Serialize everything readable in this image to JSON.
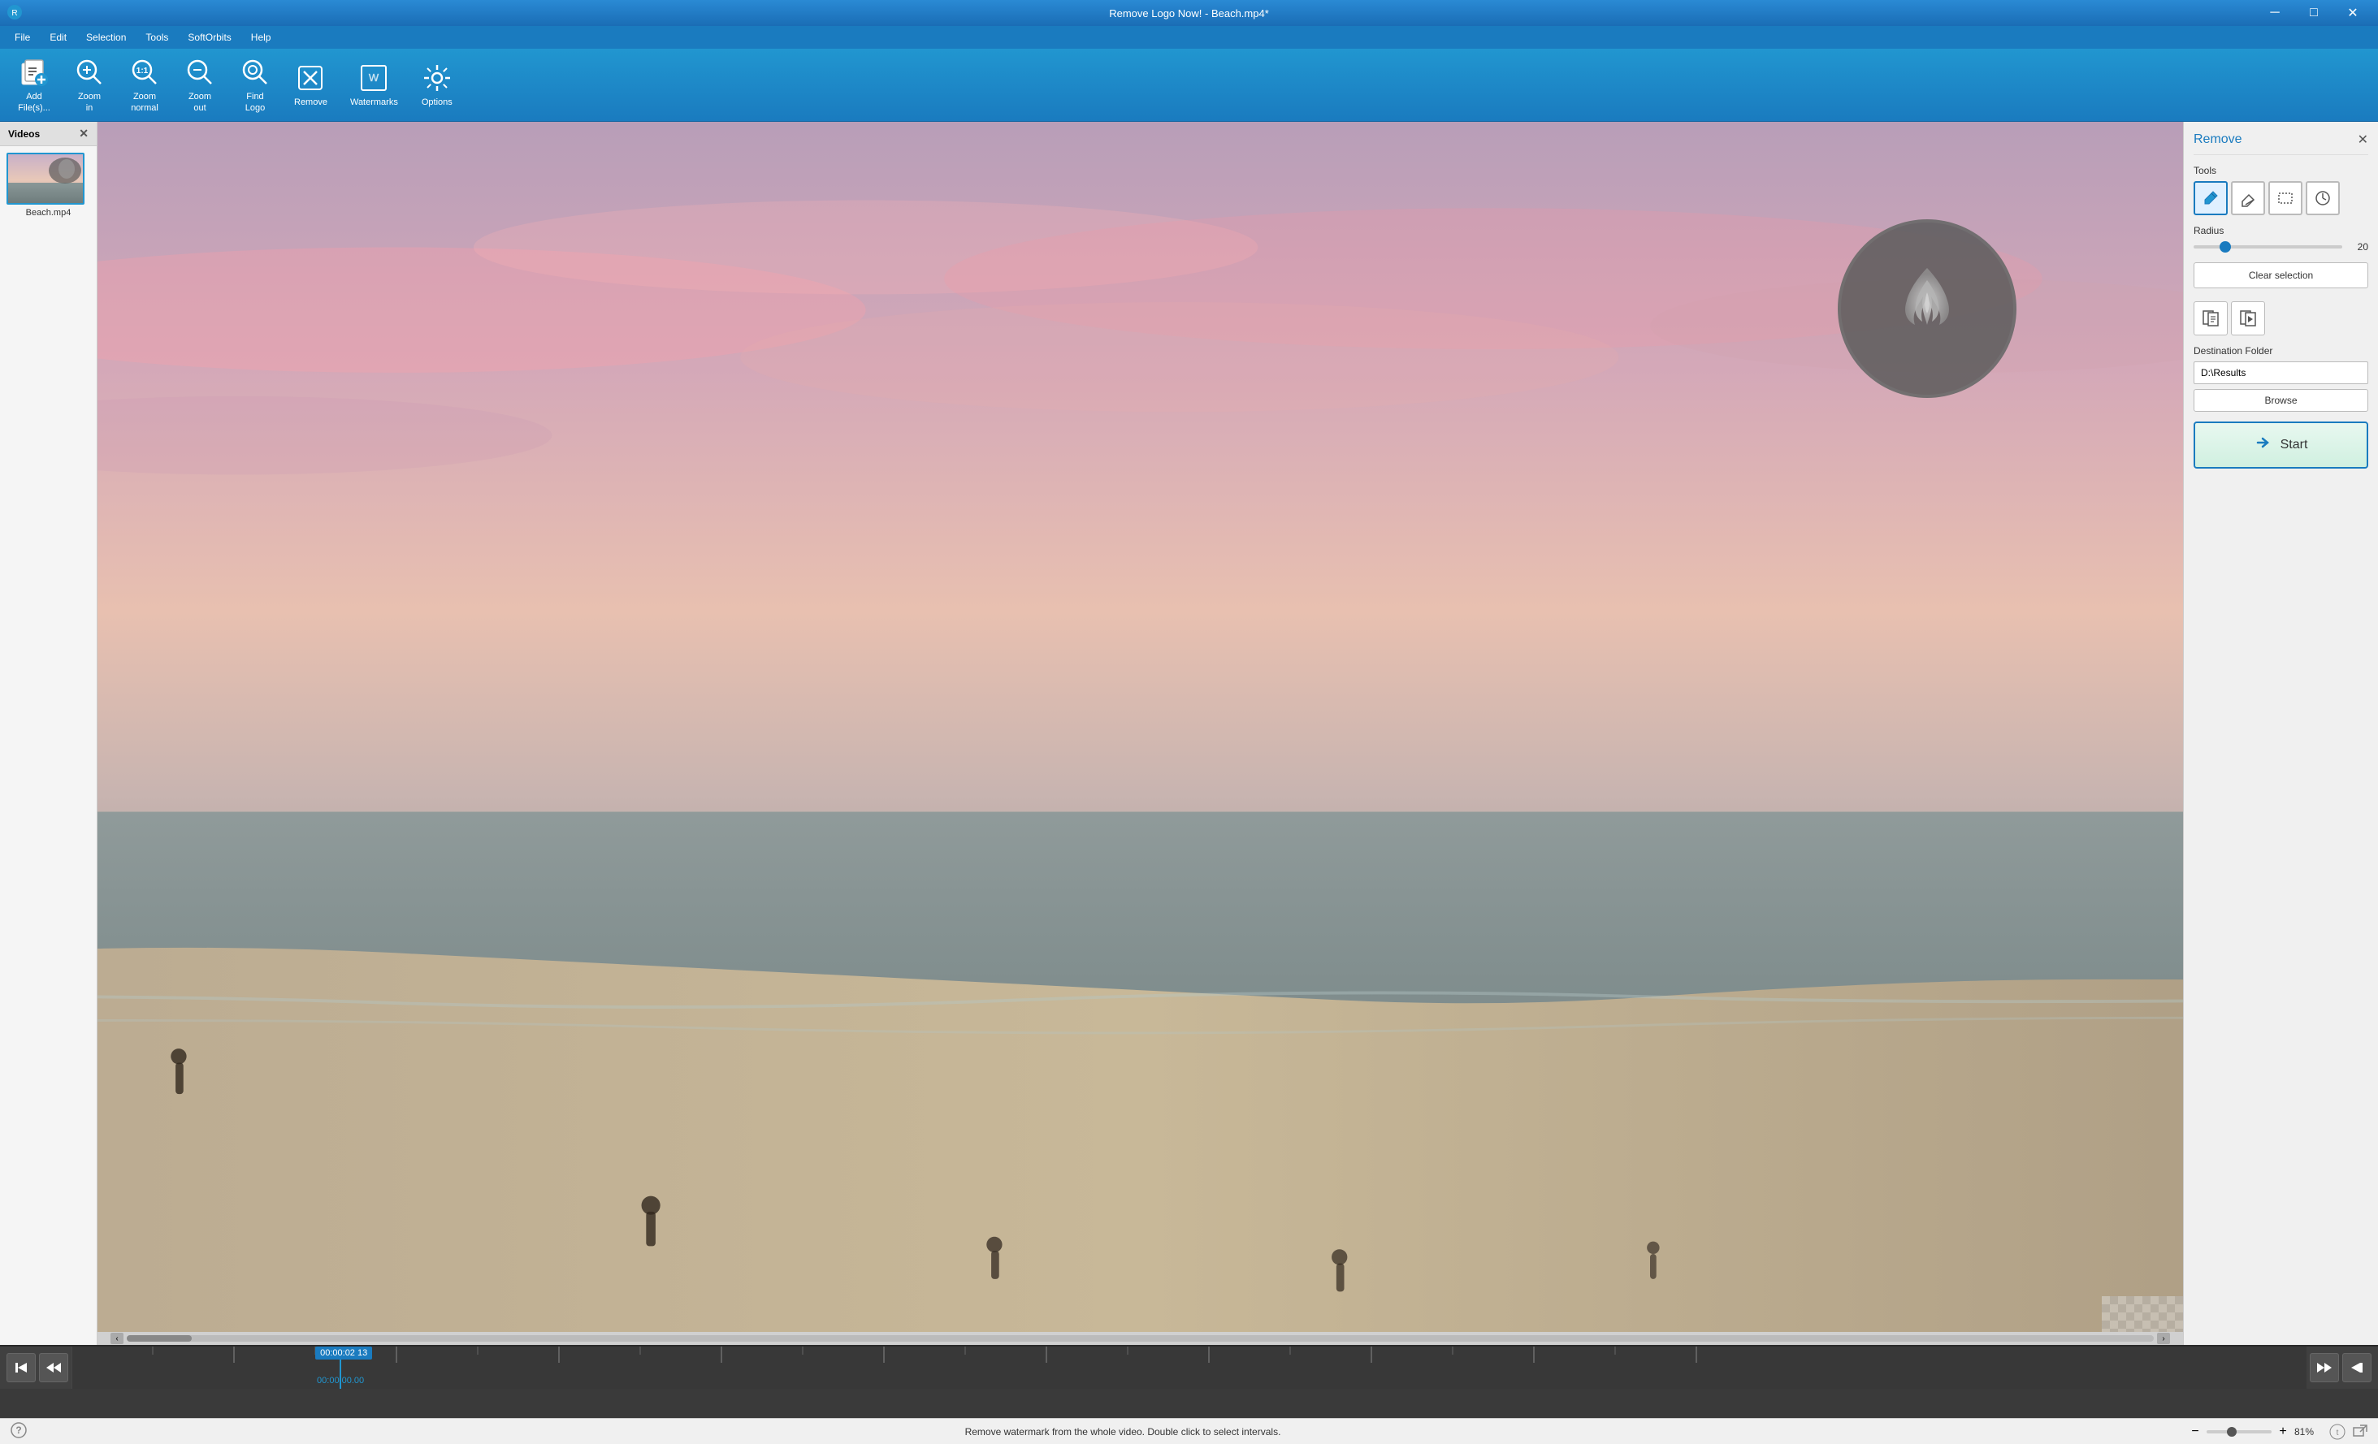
{
  "app": {
    "title": "Remove Logo Now! - Beach.mp4*"
  },
  "titlebar": {
    "icon": "🎬",
    "minimize_label": "─",
    "maximize_label": "□",
    "close_label": "✕"
  },
  "menu": {
    "items": [
      {
        "label": "File"
      },
      {
        "label": "Edit"
      },
      {
        "label": "Selection"
      },
      {
        "label": "Tools"
      },
      {
        "label": "SoftOrbits"
      },
      {
        "label": "Help"
      }
    ]
  },
  "toolbar": {
    "buttons": [
      {
        "label": "Add\nFile(s)...",
        "icon": "add"
      },
      {
        "label": "Zoom\nin",
        "icon": "zoom-in"
      },
      {
        "label": "Zoom\nnormal",
        "icon": "zoom-normal"
      },
      {
        "label": "Zoom\nout",
        "icon": "zoom-out"
      },
      {
        "label": "Find\nLogo",
        "icon": "find"
      },
      {
        "label": "Remove",
        "icon": "remove"
      },
      {
        "label": "Watermarks",
        "icon": "watermarks"
      },
      {
        "label": "Options",
        "icon": "options"
      }
    ]
  },
  "sidebar": {
    "title": "Videos",
    "video": {
      "name": "Beach.mp4"
    }
  },
  "right_panel": {
    "title": "Remove",
    "tools": {
      "label": "Tools",
      "buttons": [
        {
          "id": "brush",
          "active": true,
          "icon": "✏"
        },
        {
          "id": "eraser",
          "active": false,
          "icon": "◇"
        },
        {
          "id": "rect",
          "active": false,
          "icon": "▭"
        },
        {
          "id": "clock",
          "active": false,
          "icon": "⏱"
        }
      ]
    },
    "radius": {
      "label": "Radius",
      "value": 20,
      "min": 1,
      "max": 100
    },
    "clear_selection": "Clear selection",
    "copy_buttons": [
      {
        "id": "copy-from",
        "icon": "◫"
      },
      {
        "id": "copy-to",
        "icon": "◨"
      }
    ],
    "destination": {
      "label": "Destination Folder",
      "value": "D:\\Results",
      "browse_label": "Browse"
    },
    "start_label": "Start"
  },
  "timeline": {
    "time_marker": "00:00:02 13",
    "time_current": "00:00:00.00",
    "buttons_left": [
      {
        "id": "go-start",
        "icon": "⏮"
      },
      {
        "id": "play-back",
        "icon": "⏪"
      }
    ],
    "buttons_right": [
      {
        "id": "go-end-frame",
        "icon": "⏭"
      },
      {
        "id": "go-end",
        "icon": "⏩"
      }
    ]
  },
  "status_bar": {
    "message": "Remove watermark from the whole video. Double click to select intervals.",
    "zoom_value": "81%",
    "zoom_minus": "−",
    "zoom_plus": "+"
  }
}
